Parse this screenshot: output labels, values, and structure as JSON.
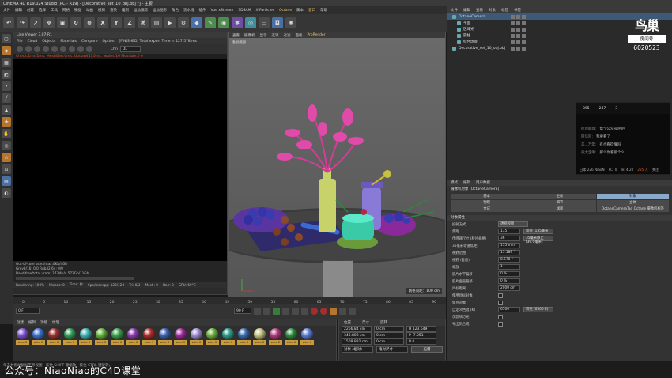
{
  "window": {
    "title": "CINEMA 4D R19.024 Studio (RC - R19) - [Decorative_set_10_obj.obj *] - 主要"
  },
  "menubar": {
    "items": [
      "文件",
      "编辑",
      "创建",
      "选择",
      "工具",
      "网格",
      "捕捉",
      "动画",
      "模拟",
      "渲染",
      "雕刻",
      "运动跟踪",
      "运动图形",
      "角色",
      "流水线",
      "插件",
      "Vue xStream",
      "3DSAM",
      "X-Particles",
      "Octane",
      "脚本",
      "窗口",
      "帮助"
    ]
  },
  "toolbar": {
    "axis_x": "X",
    "axis_y": "Y",
    "axis_z": "Z"
  },
  "live_viewer": {
    "title": "Live Viewer 3.07-R1",
    "menu": [
      "File",
      "Cloud",
      "Objects",
      "Materials",
      "Compare",
      "Option",
      "[FINISHED] Total export Time = 127.578 ms"
    ],
    "channel": "Chn",
    "channel_value": "DL",
    "status": "Check:1ms/1ms. MeshGen:0ms. Update[1]:0ms. Nodes:16 Movable:0 0",
    "info": [
      "Out-of-core used/max:0Kb/4Gb",
      "Grey8/16: 0/0        Rgb32/64: 0/0",
      "Used/free/total vram: 273Mb/4.573Gb/11Gb"
    ],
    "render_line": [
      "Rendering: 100%",
      "Ms/sec: 0",
      "Time: 秒",
      "Spp/maxspp: 128/128",
      "Tri: 0/3",
      "Mesh: 0",
      "Hair: 0",
      "GPU: 69°C"
    ]
  },
  "viewport": {
    "menu": [
      "查看",
      "摄像机",
      "显示",
      "选项",
      "过滤",
      "面板",
      "ProRender"
    ],
    "label": "透视视图",
    "grid": "网格间距：100 cm"
  },
  "timeline": {
    "ticks": [
      "0",
      "5",
      "10",
      "15",
      "20",
      "25",
      "30",
      "35",
      "40",
      "45",
      "50",
      "55",
      "60",
      "65",
      "70",
      "75",
      "80",
      "85",
      "90"
    ],
    "start_field": "0 F",
    "end_field": "90 F",
    "current": "0 F"
  },
  "materials": {
    "menu": [
      "创建",
      "编辑",
      "功能",
      "纹理"
    ],
    "items": [
      {
        "label": "wire 0",
        "color": "#7a4fd0"
      },
      {
        "label": "wire 0",
        "color": "#3a6fd0"
      },
      {
        "label": "wire 0",
        "color": "#9a3030"
      },
      {
        "label": "wire 0",
        "color": "#2f9a55"
      },
      {
        "label": "wire 0",
        "color": "#3fb0b0"
      },
      {
        "label": "wire 0",
        "color": "#5fb03a"
      },
      {
        "label": "wire 0",
        "color": "#3aa04a"
      },
      {
        "label": "wire 0",
        "color": "#8a3ab0"
      },
      {
        "label": "wire 1",
        "color": "#b02a2a"
      },
      {
        "label": "wire 0",
        "color": "#3a5fb0"
      },
      {
        "label": "wire 0",
        "color": "#9a2a9a"
      },
      {
        "label": "wire 0",
        "color": "#9a8ad0"
      },
      {
        "label": "wire 0",
        "color": "#6ab03a"
      },
      {
        "label": "wire 0",
        "color": "#2a9a8a"
      },
      {
        "label": "wire 0",
        "color": "#3a6ab0"
      },
      {
        "label": "wire 0",
        "color": "#c0c07a"
      },
      {
        "label": "wire 2",
        "color": "#b03a7a"
      },
      {
        "label": "wire 0",
        "color": "#2a8a3a"
      },
      {
        "label": "wire 0",
        "color": "#5a7ad0"
      }
    ]
  },
  "coords": {
    "headers": [
      "位置",
      "尺寸",
      "旋转"
    ],
    "rows": [
      [
        "2266.84 cm",
        "0 cm",
        "H  123.649"
      ],
      [
        "343.808 cm",
        "0 cm",
        "P  -7.051"
      ],
      [
        "1509.831 cm",
        "0 cm",
        "B  0"
      ]
    ],
    "mode_a": "对象 (相对)",
    "mode_b": "绝对尺寸",
    "apply": "应用"
  },
  "bottom": {
    "tip": "单击并拖动鼠标平移视图，按住 SHIFT 键缩放，按住 CTRL 键旋转。",
    "watermark": "公众号：NiaoNiao的C4D课堂"
  },
  "object_manager": {
    "menu": [
      "文件",
      "编辑",
      "查看",
      "对象",
      "标签",
      "书签"
    ],
    "rows": [
      {
        "name": "OctaneCamera",
        "style": "sel"
      },
      {
        "name": "平面",
        "style": ""
      },
      {
        "name": "区域光",
        "style": ""
      },
      {
        "name": "圆柱",
        "style": ""
      },
      {
        "name": "综合场景",
        "style": ""
      },
      {
        "name": "Decorative_set_10_obj.obj",
        "style": ""
      }
    ]
  },
  "logo": {
    "big": "鸟巢",
    "sub": "房间号",
    "num": "6020523"
  },
  "chat": {
    "top": [
      "895",
      "247",
      "3"
    ],
    "lines": [
      {
        "who": "提现助理:",
        "msg": "帮个公众号吧吧"
      },
      {
        "who": "阿信阿:",
        "msg": "我要看了"
      },
      {
        "who": "美...万年:",
        "msg": "有点看得懂吗"
      },
      {
        "who": "张大宝啊:",
        "msg": "那么你看那个么"
      }
    ],
    "foot": [
      "日本 226 NiaoN",
      "PC: 0",
      "Ie: 4.20",
      "285 人",
      "关注"
    ]
  },
  "attributes": {
    "menu": [
      "模式",
      "编辑",
      "用户数据"
    ],
    "head": "摄像机对象 [OctaneCamera]",
    "tabs": [
      {
        "label": "基本",
        "on": false
      },
      {
        "label": "坐标",
        "on": false
      },
      {
        "label": "对象",
        "on": true
      },
      {
        "label": "物理",
        "on": false
      },
      {
        "label": "细节",
        "on": false
      },
      {
        "label": "立体",
        "on": false
      },
      {
        "label": "合成",
        "on": false
      },
      {
        "label": "球面",
        "on": false
      },
      {
        "label": "OctaneCameraTag Octane 摄像机标签",
        "on": false
      }
    ],
    "section": "对象属性",
    "rows": [
      {
        "k": "投射方式",
        "v": "",
        "d": "透视视图"
      },
      {
        "k": "焦距",
        "v": "135",
        "d": "电视 (135毫米)"
      },
      {
        "k": "传感器尺寸 (胶片规格)",
        "v": "36",
        "d": "35毫米静止 (36.0毫米)"
      },
      {
        "k": "35毫米等值焦距:",
        "v": "135 mm",
        "d": ""
      },
      {
        "k": "视野范围",
        "v": "15.189 °",
        "d": ""
      },
      {
        "k": "视野 (垂直)",
        "v": "8.578 °",
        "d": ""
      },
      {
        "k": "缩放",
        "v": "1",
        "d": ""
      },
      {
        "k": "胶片水平偏移",
        "v": "0 %",
        "d": ""
      },
      {
        "k": "胶片垂直偏移",
        "v": "0 %",
        "d": ""
      },
      {
        "k": "目标距离",
        "v": "2000 cm",
        "d": ""
      },
      {
        "k": "使用目标对象",
        "v": "",
        "d": ""
      },
      {
        "k": "焦点对象",
        "v": "",
        "d": ""
      },
      {
        "k": "自定义色温 (K)",
        "v": "6500",
        "d": "日光 (6500 K)"
      },
      {
        "k": "仅影响灯光",
        "v": "",
        "d": ""
      },
      {
        "k": "导出到合成",
        "v": "",
        "d": ""
      }
    ]
  }
}
